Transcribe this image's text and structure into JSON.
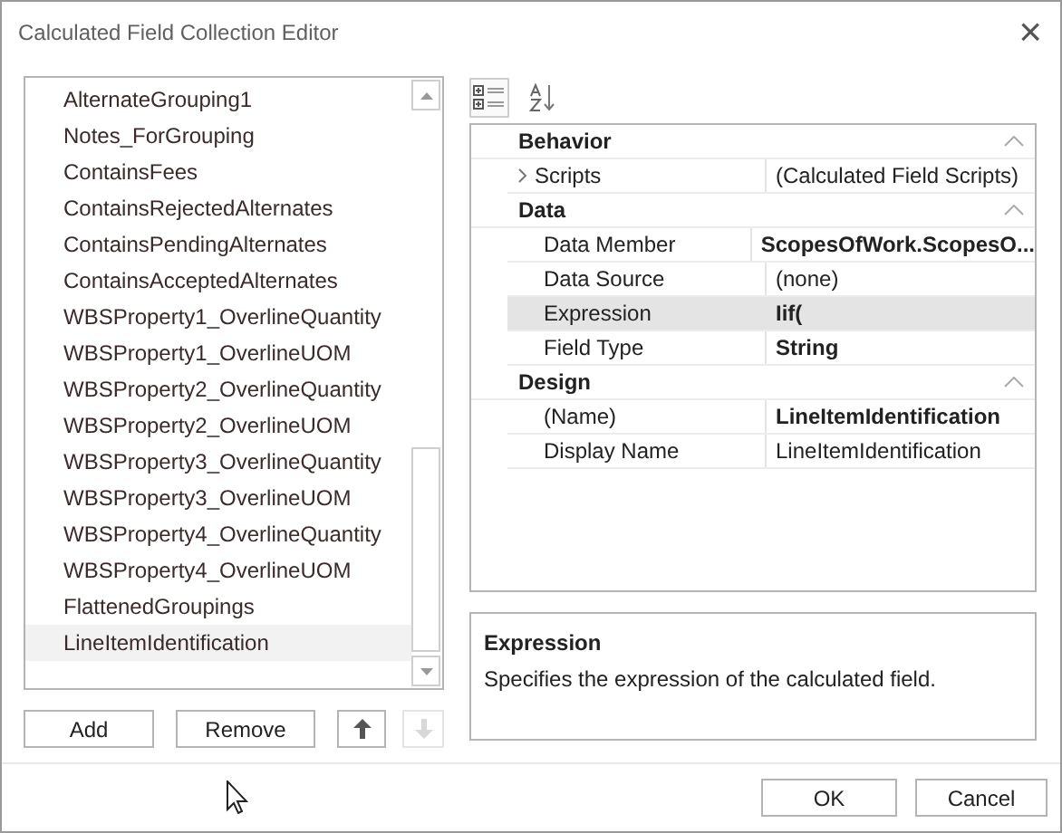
{
  "window": {
    "title": "Calculated Field Collection Editor",
    "close": "×"
  },
  "fields": [
    {
      "name": "AlternateGrouping1",
      "selected": false
    },
    {
      "name": "Notes_ForGrouping",
      "selected": false
    },
    {
      "name": "ContainsFees",
      "selected": false
    },
    {
      "name": "ContainsRejectedAlternates",
      "selected": false
    },
    {
      "name": "ContainsPendingAlternates",
      "selected": false
    },
    {
      "name": "ContainsAcceptedAlternates",
      "selected": false
    },
    {
      "name": "WBSProperty1_OverlineQuantity",
      "selected": false
    },
    {
      "name": "WBSProperty1_OverlineUOM",
      "selected": false
    },
    {
      "name": "WBSProperty2_OverlineQuantity",
      "selected": false
    },
    {
      "name": "WBSProperty2_OverlineUOM",
      "selected": false
    },
    {
      "name": "WBSProperty3_OverlineQuantity",
      "selected": false
    },
    {
      "name": "WBSProperty3_OverlineUOM",
      "selected": false
    },
    {
      "name": "WBSProperty4_OverlineQuantity",
      "selected": false
    },
    {
      "name": "WBSProperty4_OverlineUOM",
      "selected": false
    },
    {
      "name": "FlattenedGroupings",
      "selected": false
    },
    {
      "name": "LineItemIdentification",
      "selected": true
    }
  ],
  "list_buttons": [
    {
      "label": "Add"
    },
    {
      "label": "Remove"
    }
  ],
  "move_buttons": [
    {
      "kind": "up",
      "disabled": false
    },
    {
      "kind": "down",
      "disabled": true
    }
  ],
  "grid_toolbar": [
    {
      "kind": "categorized",
      "selected": true
    },
    {
      "kind": "alphabetical",
      "selected": false
    }
  ],
  "categories": [
    {
      "name": "Behavior",
      "expanded": true,
      "properties": [
        {
          "name": "Scripts",
          "value": "(Calculated Field Scripts)",
          "expandable": true,
          "modified": false,
          "selected": false
        }
      ]
    },
    {
      "name": "Data",
      "expanded": true,
      "properties": [
        {
          "name": "Data Member",
          "value": "ScopesOfWork.ScopesO...",
          "expandable": false,
          "modified": true,
          "selected": false
        },
        {
          "name": "Data Source",
          "value": "(none)",
          "expandable": false,
          "modified": false,
          "selected": false
        },
        {
          "name": "Expression",
          "value": "Iif(",
          "expandable": false,
          "modified": true,
          "selected": true
        },
        {
          "name": "Field Type",
          "value": "String",
          "expandable": false,
          "modified": true,
          "selected": false
        }
      ]
    },
    {
      "name": "Design",
      "expanded": true,
      "properties": [
        {
          "name": "(Name)",
          "value": "LineItemIdentification",
          "expandable": false,
          "modified": true,
          "selected": false
        },
        {
          "name": "Display Name",
          "value": "LineItemIdentification",
          "expandable": false,
          "modified": false,
          "selected": false
        }
      ]
    }
  ],
  "description": {
    "title": "Expression",
    "text": "Specifies the expression of the calculated field."
  },
  "dialog_buttons": [
    {
      "label": "OK"
    },
    {
      "label": "Cancel"
    }
  ]
}
